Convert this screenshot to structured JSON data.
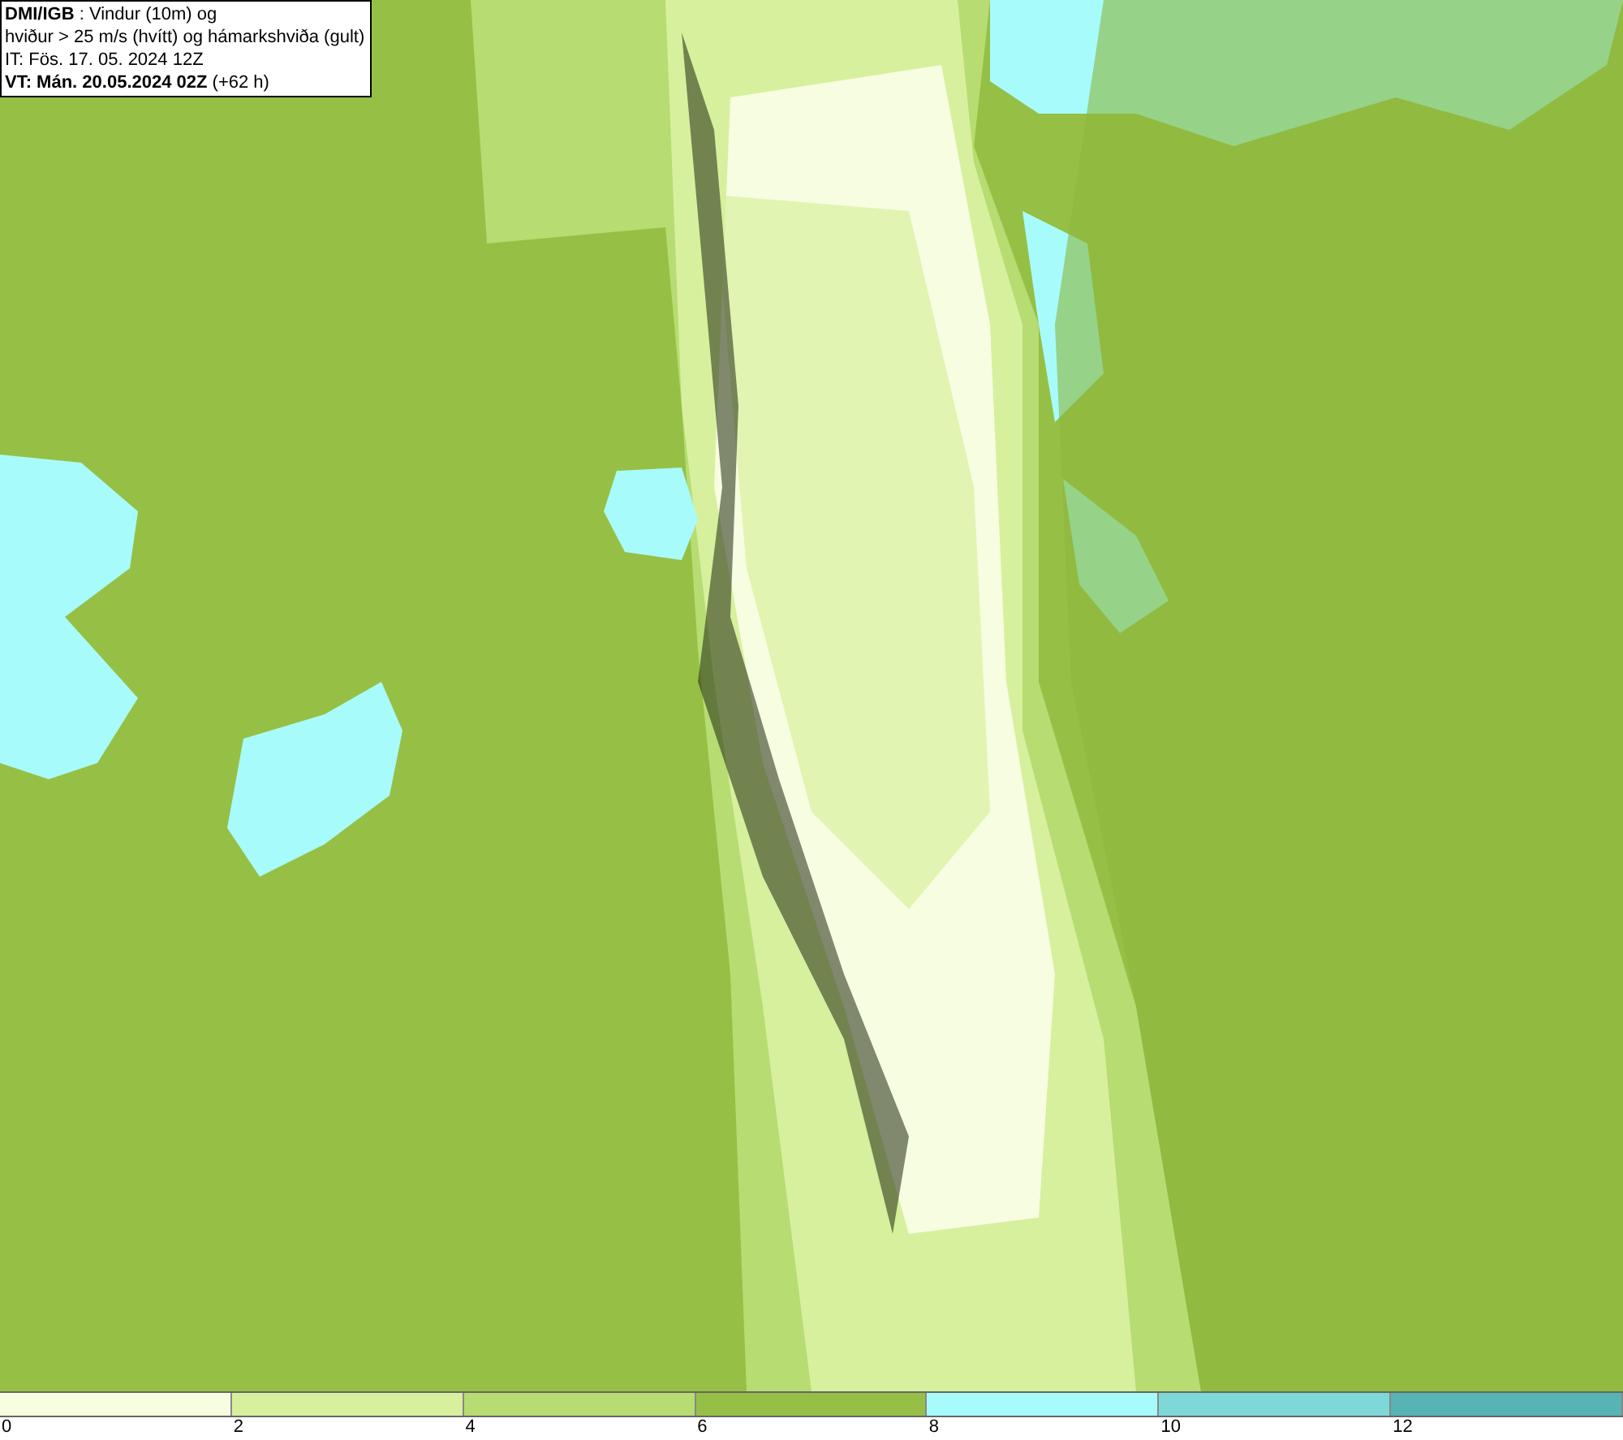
{
  "info_box": {
    "lines": [
      "**DMI/IGB** : Vindur (10m) og",
      "hviður > 25 m/s (hvítt) og hámarkshviða (gult)",
      "IT: Fös. 17. 05. 2024 12Z",
      "**VT: Mán. 20.05.2024 02Z** (+62 h)"
    ]
  },
  "legend": {
    "segments": [
      {
        "label": "0",
        "color": "#f7fde0"
      },
      {
        "label": "2",
        "color": "#d7f09e"
      },
      {
        "label": "4",
        "color": "#b7dc72"
      },
      {
        "label": "6",
        "color": "#96c045"
      },
      {
        "label": "8",
        "color": "#a8fbfb"
      },
      {
        "label": "10",
        "color": "#7ed8d8"
      },
      {
        "label": "12",
        "color": "#57b4b4"
      }
    ]
  }
}
